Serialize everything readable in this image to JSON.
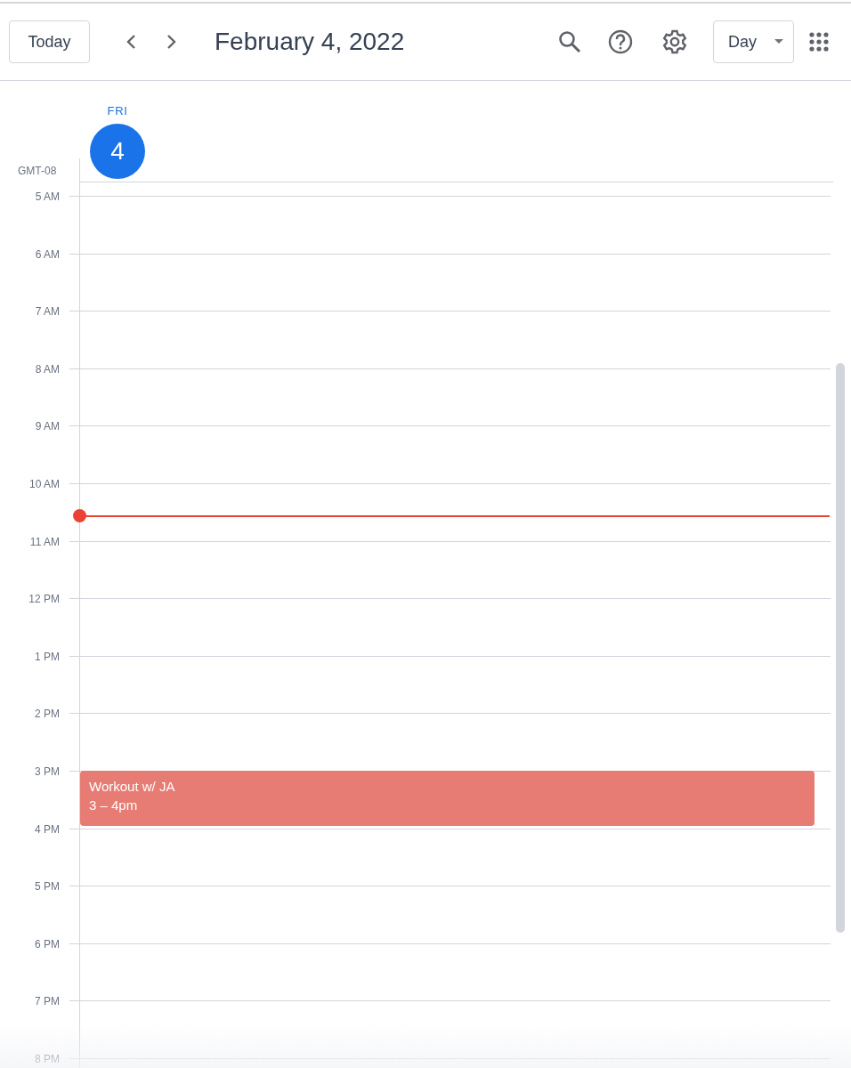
{
  "toolbar": {
    "today_button": "Today",
    "title": "February 4, 2022",
    "view_selector": "Day"
  },
  "day_header": {
    "weekday": "FRI",
    "date": "4",
    "today": true
  },
  "timezone": "GMT-08",
  "hours": [
    {
      "label": "5 AM",
      "current_time": false
    },
    {
      "label": "6 AM",
      "current_time": false
    },
    {
      "label": "7 AM",
      "current_time": false
    },
    {
      "label": "8 AM",
      "current_time": false
    },
    {
      "label": "9 AM",
      "current_time": false
    },
    {
      "label": "10 AM",
      "current_time": true
    },
    {
      "label": "11 AM",
      "current_time": false
    },
    {
      "label": "12 PM",
      "current_time": false
    },
    {
      "label": "1 PM",
      "current_time": false
    },
    {
      "label": "2 PM",
      "current_time": false
    },
    {
      "label": "3 PM",
      "current_time": false,
      "events": [
        {
          "title": "Workout w/ JA",
          "time": "3 – 4pm",
          "color": "#e67c73"
        }
      ]
    },
    {
      "label": "4 PM",
      "current_time": false
    },
    {
      "label": "5 PM",
      "current_time": false
    },
    {
      "label": "6 PM",
      "current_time": false
    },
    {
      "label": "7 PM",
      "current_time": false
    },
    {
      "label": "8 PM",
      "current_time": false
    }
  ]
}
